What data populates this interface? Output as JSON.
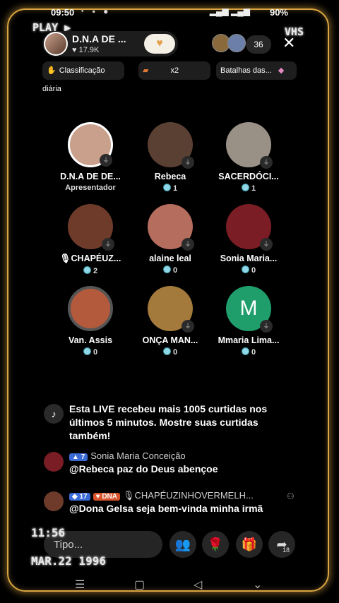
{
  "status_bar": {
    "time": "09:50",
    "battery": "90%"
  },
  "overlay": {
    "play": "PLAY ▶",
    "vhs": "VHS",
    "clock": "11:56",
    "date": "MAR.22 1996"
  },
  "host": {
    "name": "D.N.A  DE ...",
    "likes": "17.9K"
  },
  "viewers": {
    "count": "36"
  },
  "pills": {
    "ranking": "Classificação diária",
    "multiplier": "x2",
    "battles": "Batalhas das..."
  },
  "guests": [
    {
      "name": "D.N.A  DE DE...",
      "sub": "Apresentador",
      "color": "#c9a08c"
    },
    {
      "name": "Rebeca",
      "sub": "1",
      "color": "#5a3f33"
    },
    {
      "name": "SACERDÓCI...",
      "sub": "1",
      "color": "#9a9186"
    },
    {
      "name": "CHAPÉUZ...",
      "sub": "2",
      "color": "#6e3b2a"
    },
    {
      "name": "alaine leal",
      "sub": "0",
      "color": "#b56d5e"
    },
    {
      "name": "Sonia Maria...",
      "sub": "0",
      "color": "#7a1d24"
    },
    {
      "name": "Van. Assis",
      "sub": "0",
      "color": "#b45a3c"
    },
    {
      "name": "ONÇA MAN...",
      "sub": "0",
      "color": "#a37a3c"
    },
    {
      "name": "Mmaria Lima...",
      "sub": "0",
      "color": "#1f9e6b",
      "initial": "M"
    }
  ],
  "feed": {
    "system": "Esta LIVE recebeu mais 1005 curtidas nos últimos 5 minutos. Mostre suas curtidas também!",
    "comments": [
      {
        "level": "7",
        "user": "Sonia Maria Conceição",
        "text": "@Rebeca paz do Deus abençoe"
      },
      {
        "level": "17",
        "team": "DNA",
        "user": "CHAPÉUZINHOVERMELH...",
        "text": "@Dona Gelsa seja bem-vinda minha irmã"
      }
    ]
  },
  "bottom": {
    "placeholder": "Tipo...",
    "share_count": "18"
  },
  "colors": {
    "frame": "#d9a441",
    "panel": "#1e1e1e",
    "coin": "#8fd6e6"
  }
}
